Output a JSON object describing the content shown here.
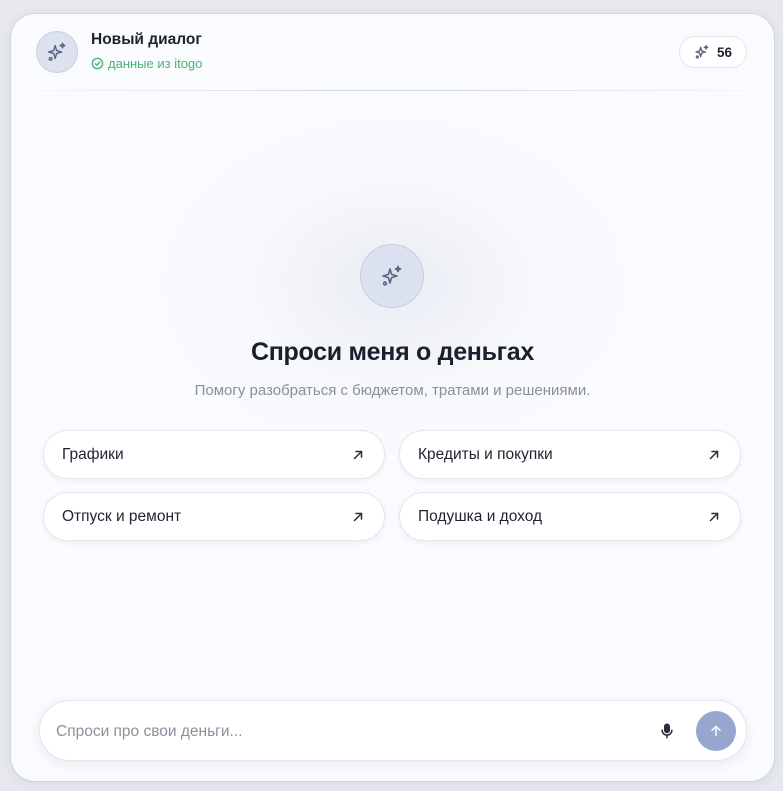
{
  "header": {
    "title": "Новый диалог",
    "source_text": "данные из itogo",
    "credits": "56",
    "avatar_icon": "sparkles-icon",
    "source_icon": "check-circle-icon",
    "credits_icon": "sparkles-icon"
  },
  "hero": {
    "icon": "sparkles-icon",
    "title": "Спроси меня о деньгах",
    "subtitle": "Помогу разобраться с бюджетом, тратами и решениями."
  },
  "suggestions": [
    {
      "label": "Графики",
      "icon": "arrow-up-right-icon"
    },
    {
      "label": "Кредиты и покупки",
      "icon": "arrow-up-right-icon"
    },
    {
      "label": "Отпуск и ремонт",
      "icon": "arrow-up-right-icon"
    },
    {
      "label": "Подушка и доход",
      "icon": "arrow-up-right-icon"
    }
  ],
  "composer": {
    "placeholder": "Спроси про свои деньги...",
    "value": "",
    "mic_icon": "microphone-icon",
    "send_icon": "arrow-up-icon"
  },
  "colors": {
    "accent": "#98a5cf",
    "success": "#4caf73",
    "icon": "#5b6485",
    "background": "#fafbfe"
  }
}
